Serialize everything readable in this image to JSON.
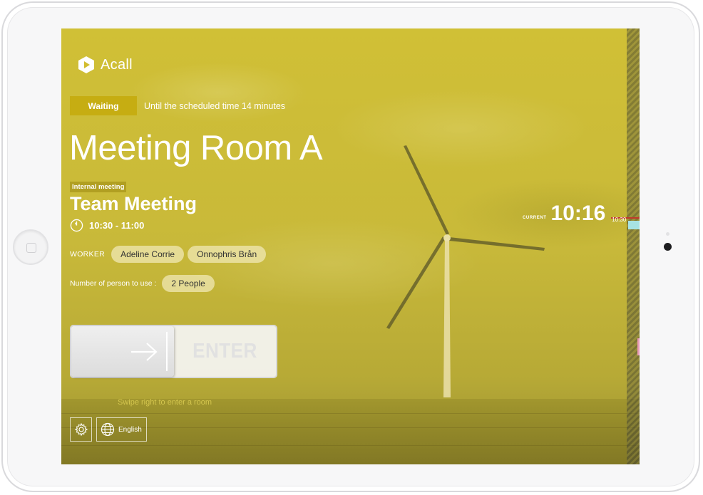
{
  "app": {
    "logo_text": "Acall"
  },
  "status": {
    "badge": "Waiting",
    "text": "Until the scheduled time 14 minutes",
    "color": "#c6ad12"
  },
  "room": {
    "name": "Meeting Room A"
  },
  "meeting": {
    "tag": "Internal meeting",
    "title": "Team Meeting",
    "time": "10:30 - 11:00"
  },
  "workers": {
    "label": "WORKER",
    "names": [
      "Adeline Corrie",
      "Onnophris Brån"
    ]
  },
  "people": {
    "label": "Number of person to use :",
    "value": "2 People"
  },
  "swipe": {
    "button_label": "ENTER",
    "hint": "Swipe right to enter a room"
  },
  "bottom": {
    "language": "English",
    "settings_icon": "gear-icon",
    "language_icon": "globe-icon"
  },
  "clock": {
    "label": "CURRENT",
    "time": "10:16",
    "slot_time": "10:30"
  },
  "colors": {
    "overlay": "#d6c430",
    "timeline_slot": "#a7e3e3",
    "now_marker": "#c0392b"
  }
}
